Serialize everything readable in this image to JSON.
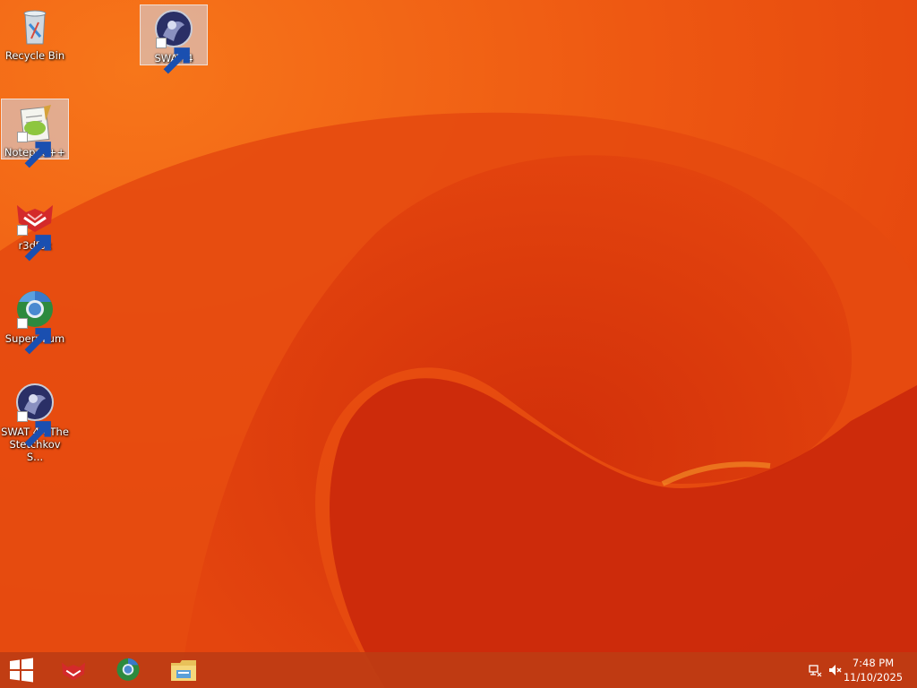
{
  "desktop": {
    "icons": [
      {
        "label": "Recycle Bin",
        "icon": "recycle-bin-icon"
      },
      {
        "label": "SWAT 4",
        "icon": "swat4-icon"
      },
      {
        "label": "Notepad++",
        "icon": "notepadpp-icon"
      },
      {
        "label": "r3dfox",
        "icon": "r3dfox-icon"
      },
      {
        "label": "Supermium",
        "icon": "supermium-icon"
      },
      {
        "label": "SWAT 4 - The Stetchkov S...",
        "icon": "swat4-icon"
      }
    ]
  },
  "taskbar": {
    "start_icon": "windows-logo-icon",
    "pinned": [
      {
        "icon": "r3dfox-icon"
      },
      {
        "icon": "supermium-icon"
      },
      {
        "icon": "file-explorer-icon"
      }
    ],
    "tray": {
      "network_icon": "network-icon",
      "volume_icon": "volume-muted-icon",
      "time": "7:48 PM",
      "date": "11/10/2025"
    }
  },
  "colors": {
    "wallpaper_base": "#e4450e",
    "wallpaper_dark": "#c92608",
    "wallpaper_light": "#f76a12",
    "taskbar": "#be3c14"
  }
}
